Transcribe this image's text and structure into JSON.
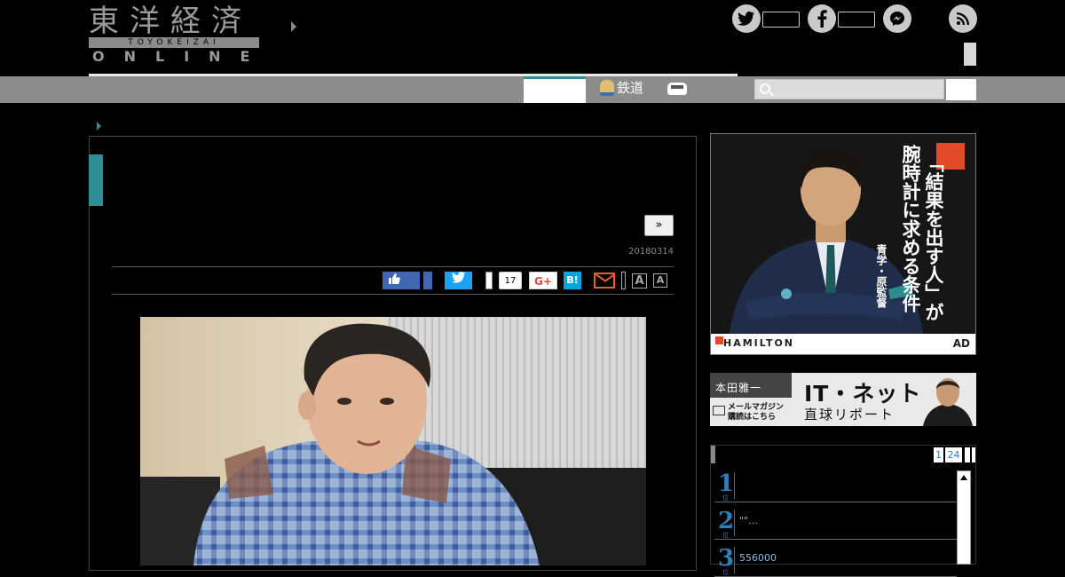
{
  "header": {
    "logo_kanji": "東洋経済",
    "logo_roman": "TOYOKEIZAI",
    "logo_online": "ONLINE"
  },
  "social": {
    "twitter_icon": "twitter-bird",
    "facebook_icon": "facebook-f",
    "messenger_icon": "messenger-bubble",
    "rss_icon": "rss-feed"
  },
  "nav": {
    "rail_label": "鉄道",
    "car_icon": "car",
    "search_placeholder": ""
  },
  "article": {
    "next_label": "»",
    "date": "20180314",
    "share": {
      "pocket_count": "17",
      "gplus_label": "G+",
      "hatena_label": "B!",
      "font_large": "A",
      "font_small": "A"
    }
  },
  "sidebar": {
    "ad1": {
      "headline1": "「結果を出す人」が",
      "headline2": "腕時計に求める条件",
      "byline": "青学・原監督",
      "brand": "HAMILTON",
      "ad_label": "AD"
    },
    "ad2": {
      "author": "本田雅一",
      "title": "IT・ネット",
      "subtitle": "直球リポート",
      "cta_line1": "メールマガジン",
      "cta_line2": "購読はこちら"
    },
    "ranking": {
      "tabs": [
        "1",
        "24"
      ],
      "items": [
        {
          "rank": "1",
          "rank_suffix": "位",
          "text": ""
        },
        {
          "rank": "2",
          "rank_suffix": "位",
          "text": "\"\"…"
        },
        {
          "rank": "3",
          "rank_suffix": "位",
          "text": "556000"
        }
      ]
    }
  },
  "colors": {
    "accent_teal": "#2f8f94",
    "ranking_blue": "#2f7fb8",
    "facebook": "#4267b2",
    "twitter": "#1da1f2",
    "hatena": "#00a4de",
    "hamilton_red": "#e24b2a"
  }
}
